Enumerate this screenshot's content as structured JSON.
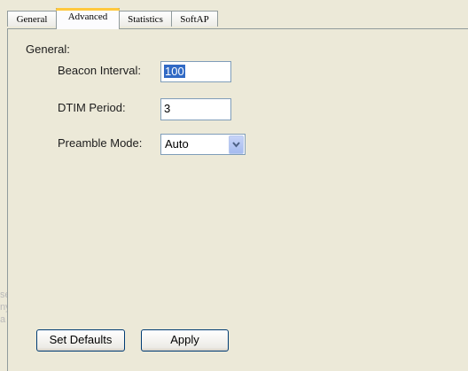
{
  "tabs": [
    {
      "label": "General",
      "active": false
    },
    {
      "label": "Advanced",
      "active": true
    },
    {
      "label": "Statistics",
      "active": false
    },
    {
      "label": "SoftAP",
      "active": false
    }
  ],
  "panel": {
    "group_label": "General:",
    "beacon_interval": {
      "label": "Beacon Interval:",
      "value": "100"
    },
    "dtim_period": {
      "label": "DTIM Period:",
      "value": "3"
    },
    "preamble_mode": {
      "label": "Preamble Mode:",
      "value": "Auto"
    }
  },
  "buttons": {
    "set_defaults": "Set Defaults",
    "apply": "Apply"
  },
  "background_ghost_text": [
    "se",
    "ny",
    "a"
  ],
  "colors": {
    "window_bg": "#ece9d8",
    "tab_highlight": "#ffc83c",
    "selection": "#316ac5",
    "field_border": "#7f9db9"
  }
}
